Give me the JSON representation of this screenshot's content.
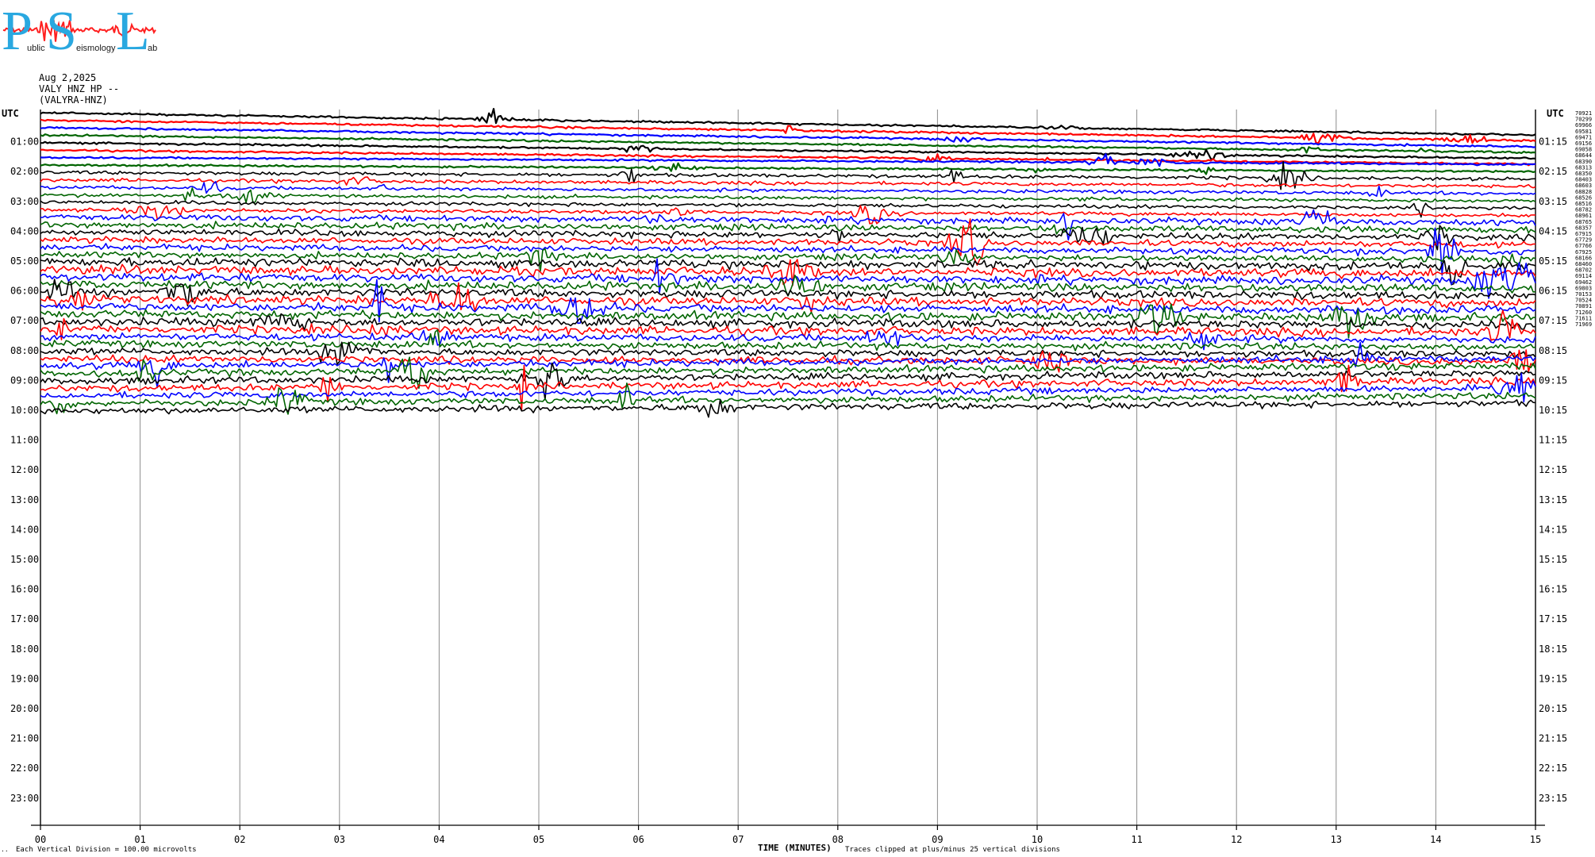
{
  "logo": {
    "letters": [
      "P",
      "S",
      "L"
    ],
    "words": [
      "ublic",
      "eismology",
      "ab"
    ],
    "colors": {
      "letters": "#29a8e0",
      "wave": "#ff2020",
      "text": "#1a1a1a"
    }
  },
  "header": {
    "date": "Aug 2,2025",
    "station": "VALY HNZ HP --",
    "location": "(VALYRA-HNZ)"
  },
  "axis": {
    "left_label": "UTC",
    "right_label": "UTC",
    "left_hours": [
      "01:00",
      "02:00",
      "03:00",
      "04:00",
      "05:00",
      "06:00",
      "07:00",
      "08:00",
      "09:00",
      "10:00",
      "11:00",
      "12:00",
      "13:00",
      "14:00",
      "15:00",
      "16:00",
      "17:00",
      "18:00",
      "19:00",
      "20:00",
      "21:00",
      "22:00",
      "23:00"
    ],
    "right_hours": [
      "01:15",
      "02:15",
      "03:15",
      "04:15",
      "05:15",
      "06:15",
      "07:15",
      "08:15",
      "09:15",
      "10:15",
      "11:15",
      "12:15",
      "13:15",
      "14:15",
      "15:15",
      "16:15",
      "17:15",
      "18:15",
      "19:15",
      "20:15",
      "21:15",
      "22:15",
      "23:15"
    ],
    "minute_ticks": [
      "00",
      "01",
      "02",
      "03",
      "04",
      "05",
      "06",
      "07",
      "08",
      "09",
      "10",
      "11",
      "12",
      "13",
      "14",
      "15"
    ],
    "xlabel": "TIME (MINUTES)"
  },
  "footer": {
    "mark": "..",
    "division_note": "Each Vertical Division =  100.00 microvolts",
    "clip_note": "Traces clipped at plus/minus 25 vertical divisions"
  },
  "chart_data": {
    "type": "line",
    "xlim": [
      0,
      15
    ],
    "rows_per_hour": 4,
    "total_rows": 96,
    "active_rows": 41,
    "series_colors": [
      "#000000",
      "#ff0000",
      "#0000ff",
      "#006400"
    ],
    "counts": [
      "70921",
      "70299",
      "69966",
      "69581",
      "69471",
      "69156",
      "69058",
      "68644",
      "68390",
      "68313",
      "68350",
      "68403",
      "68603",
      "68828",
      "68526",
      "68516",
      "68782",
      "68961",
      "68765",
      "68357",
      "67915",
      "67729",
      "67766",
      "67925",
      "68166",
      "68460",
      "68702",
      "69114",
      "69462",
      "69803",
      "70153",
      "70524",
      "70891",
      "71260",
      "71611",
      "71969"
    ]
  }
}
